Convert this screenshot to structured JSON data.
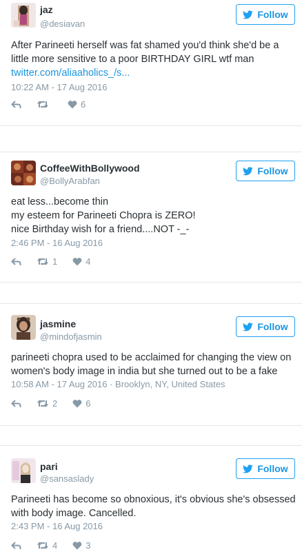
{
  "follow_label": "Follow",
  "tweets": [
    {
      "name": "jaz",
      "handle": "@desiavan",
      "lines": [
        "After Parineeti herself was fat shamed you'd think she'd be a",
        "little more sensitive to a poor BIRTHDAY GIRL wtf man"
      ],
      "link": "twitter.com/aliaaholics_/s...",
      "meta": "10:22 AM - 17 Aug 2016",
      "retweets": "",
      "likes": "6"
    },
    {
      "name": "CoffeeWithBollywood",
      "handle": "@BollyArabfan",
      "lines": [
        "eat less...become thin",
        "my esteem for Parineeti Chopra is ZERO!",
        "nice Birthday wish for a friend....NOT -_-"
      ],
      "meta": "2:46 PM - 16 Aug 2016",
      "retweets": "1",
      "likes": "4"
    },
    {
      "name": "jasmine",
      "handle": "@mindofjasmin",
      "lines": [
        "parineeti chopra used to be acclaimed for changing the view on",
        "women's body image in india but she turned out to be a fake"
      ],
      "meta": "10:58 AM - 17 Aug 2016 · Brooklyn, NY, United States",
      "retweets": "2",
      "likes": "6"
    },
    {
      "name": "pari",
      "handle": "@sansaslady",
      "lines": [
        "Parineeti has become so obnoxious, it's obvious she's obsessed",
        "with body image. Cancelled."
      ],
      "meta": "2:43 PM - 16 Aug 2016",
      "retweets": "4",
      "likes": "3"
    }
  ]
}
